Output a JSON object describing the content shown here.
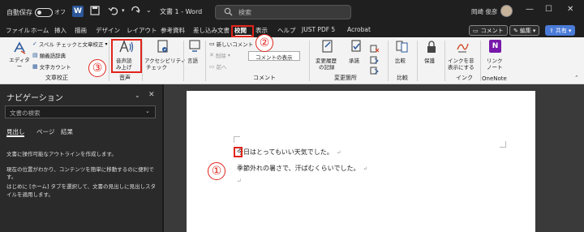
{
  "titlebar": {
    "autosave_label": "自動保存",
    "autosave_state": "オフ",
    "doc_title": "文書 1 - Word",
    "search_placeholder": "検索",
    "user_name": "岡崎 俊彦",
    "word_icon_letter": "W",
    "min_glyph": "—",
    "max_glyph": "☐",
    "close_glyph": "✕"
  },
  "menu": {
    "tabs": [
      "ファイル",
      "ホーム",
      "挿入",
      "描画",
      "デザイン",
      "レイアウト",
      "参考資料",
      "差し込み文書",
      "校閲",
      "表示",
      "ヘルプ",
      "JUST PDF 5",
      "Acrobat"
    ],
    "active_tab": "校閲",
    "comment_button": "コメント",
    "edit_button": "編集",
    "share_button": "共有"
  },
  "ribbon": {
    "editor": "エディター",
    "spell_check": "スペル チェックと文章校正",
    "thesaurus": "類義語辞典",
    "word_count": "文字カウント",
    "group_proofing": "文章校正",
    "read_aloud_line1": "音声読",
    "read_aloud_line2": "み上げ",
    "group_speech": "音声",
    "accessibility_line1": "アクセシビリティ",
    "accessibility_line2": "チェック",
    "language": "言語",
    "new_comment": "新しいコメント",
    "delete": "削除",
    "previous": "前へ",
    "show_comments": "コメントの表示",
    "group_comments": "コメント",
    "track_changes_line1": "変更履歴",
    "track_changes_line2": "の記録",
    "accept": "承諾",
    "group_changes": "変更箇所",
    "compare": "比較",
    "group_compare": "比較",
    "protect": "保護",
    "ink_line1": "インクを非",
    "ink_line2": "表示にする",
    "group_ink": "インク",
    "link_line1": "リンク",
    "link_line2": "ノート",
    "group_onenote": "OneNote"
  },
  "nav": {
    "title": "ナビゲーション",
    "search_placeholder": "文書の検索",
    "tabs": [
      "見出し",
      "ページ",
      "結果"
    ],
    "paragraphs": [
      "文書に操作可能なアウトラインを作成します。",
      "現在の位置がわかり、コンテンツを簡単に移動するのに便利です。",
      "はじめに [ホーム] タブを選択して、文書の見出しに見出しスタイルを適用します。"
    ]
  },
  "document": {
    "lines": [
      "今日はとってもいい天気でした。",
      "季節外れの暑さで、汗ばむくらいでした。"
    ],
    "para_mark": "↵"
  },
  "annotations": [
    "①",
    "②",
    "③"
  ],
  "colors": {
    "accent_red": "#e0241b",
    "share_blue": "#4a7bd8",
    "word_blue": "#2b579a",
    "onenote_purple": "#7719aa"
  }
}
